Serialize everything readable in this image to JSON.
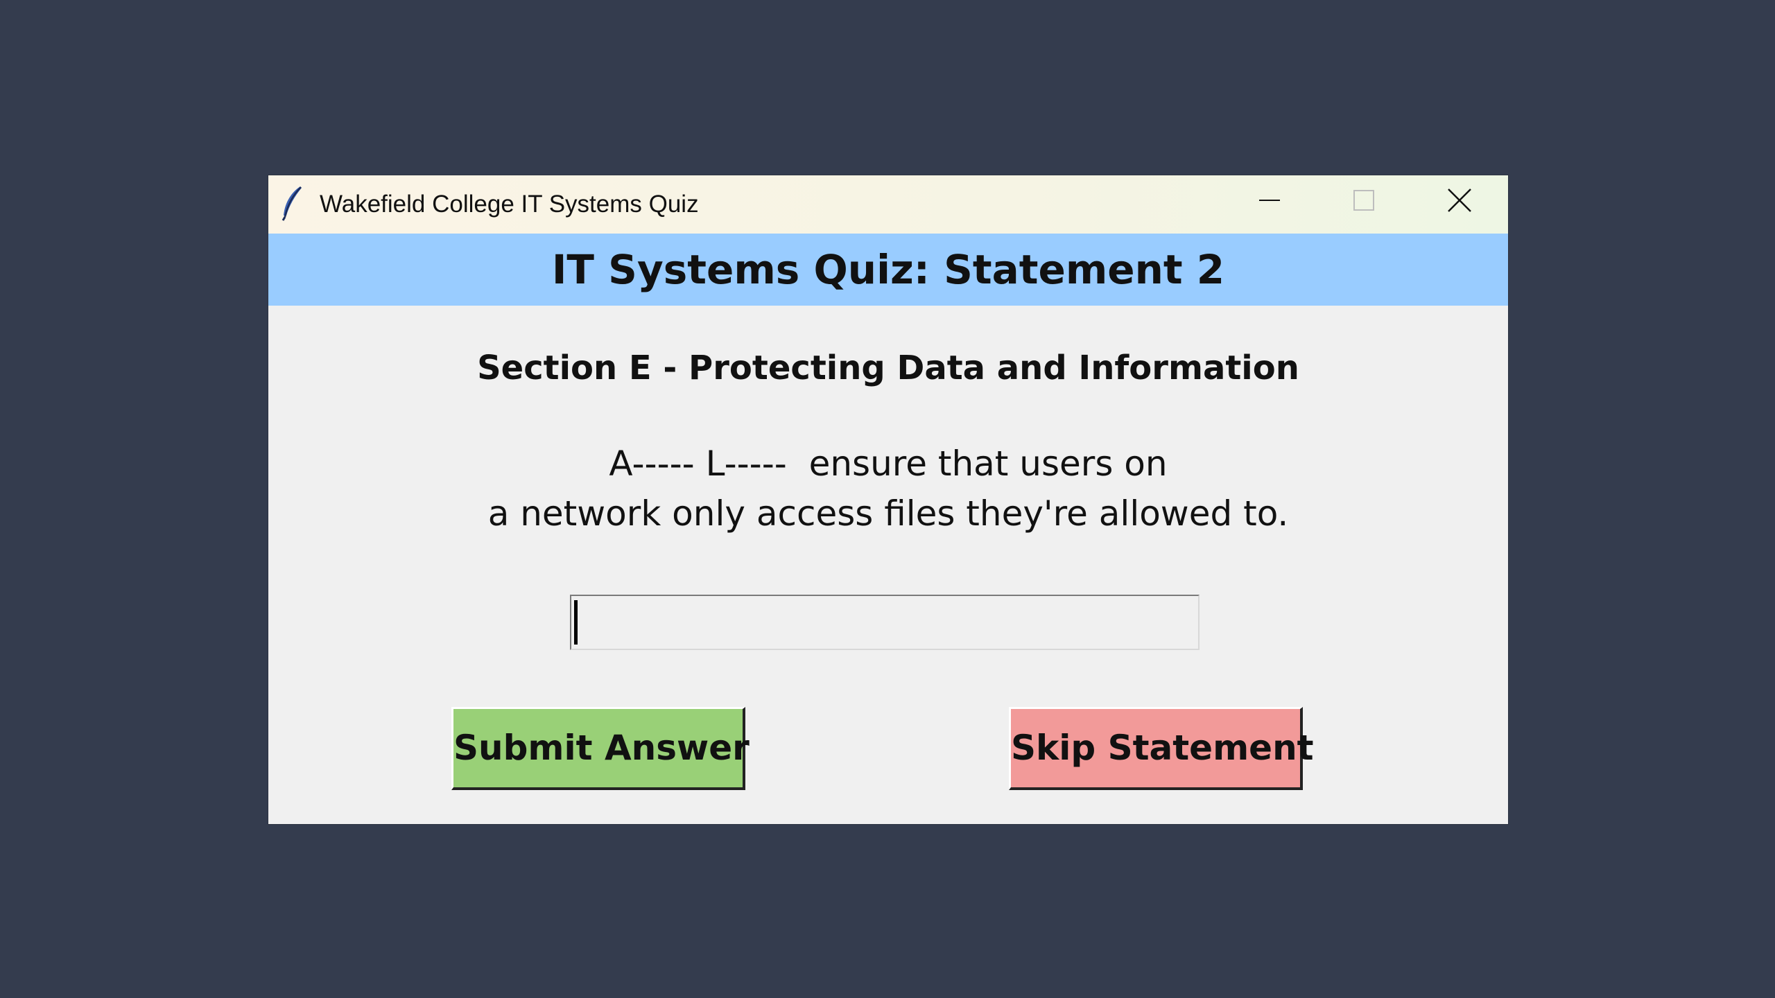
{
  "window": {
    "title": "Wakefield College IT Systems Quiz",
    "controls": {
      "minimize_icon": "minimize-icon",
      "maximize_icon": "maximize-icon",
      "close_icon": "close-icon"
    }
  },
  "quiz": {
    "header_title": "IT Systems Quiz: Statement 2",
    "section_title": "Section E - Protecting Data and Information",
    "statement_line_1": "A----- L-----  ensure that users on",
    "statement_line_2": "a network only access files they're allowed to.",
    "answer_value": "",
    "submit_label": "Submit Answer",
    "skip_label": "Skip Statement"
  },
  "colors": {
    "desktop_background": "#343c4e",
    "header_band": "#99ccff",
    "submit_button": "#99d077",
    "skip_button": "#f29a99",
    "window_body": "#f0f0f0"
  }
}
